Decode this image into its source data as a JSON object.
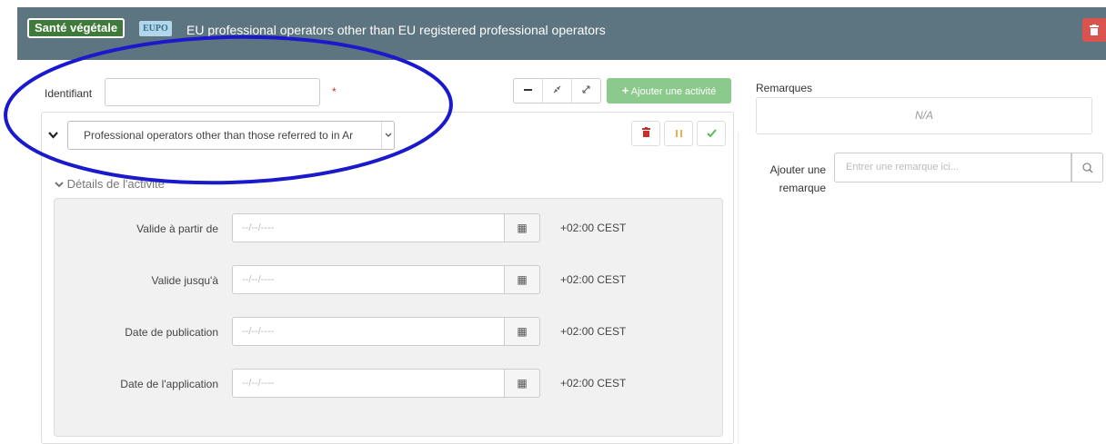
{
  "header": {
    "badge_label": "Santé végétale",
    "code_badge": "EUPO",
    "title": "EU professional operators other than EU registered professional operators",
    "trash_icon": "trash-icon"
  },
  "form": {
    "identifiant_label": "Identifiant",
    "identifiant_value": "",
    "required_marker": "*",
    "toolbar": {
      "minus_icon": "minus-icon",
      "collapse_icon": "compress-icon",
      "expand_icon": "expand-icon",
      "add_activity_label": "Ajouter une activité"
    },
    "activity": {
      "selected": "Professional operators other than those referred to in Ar",
      "details_label": "Détails de l'activité",
      "rows": [
        {
          "label": "Valide à partir de",
          "placeholder": "--/--/----",
          "timezone": "+02:00 CEST"
        },
        {
          "label": "Valide jusqu'à",
          "placeholder": "--/--/----",
          "timezone": "+02:00 CEST"
        },
        {
          "label": "Date de publication",
          "placeholder": "--/--/----",
          "timezone": "+02:00 CEST"
        },
        {
          "label": "Date de l'application",
          "placeholder": "--/--/----",
          "timezone": "+02:00 CEST"
        }
      ]
    }
  },
  "remarks": {
    "title": "Remarques",
    "value": "N/A",
    "add_label": "Ajouter une remarque",
    "input_placeholder": "Entrer une remarque ici..."
  },
  "colors": {
    "header_bg": "#5d7580",
    "badge_green": "#3f7a3a",
    "add_button": "#8cc98c",
    "danger": "#d9534f",
    "annotation": "#1a1acc"
  }
}
